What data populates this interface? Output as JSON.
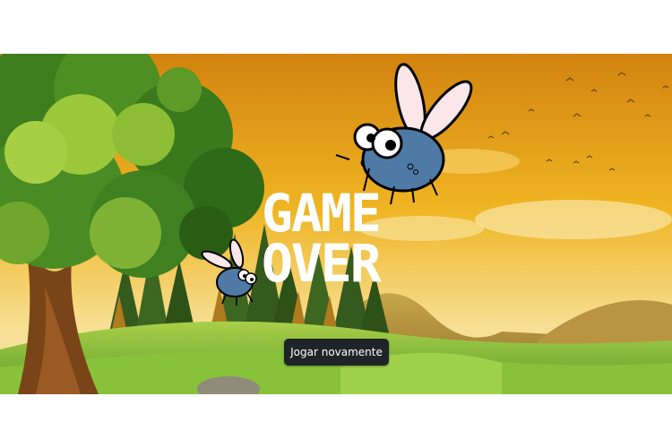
{
  "game": {
    "status_text_line1": "GAME",
    "status_text_line2": "OVER",
    "restart_button_label": "Jogar novamente"
  },
  "colors": {
    "sky_top": "#d98d10",
    "sky_bottom": "#f7e09a",
    "button_bg": "#1f2429",
    "fly_body": "#4f7aa6"
  },
  "icons": [
    "fly-icon",
    "fly-icon-small"
  ]
}
